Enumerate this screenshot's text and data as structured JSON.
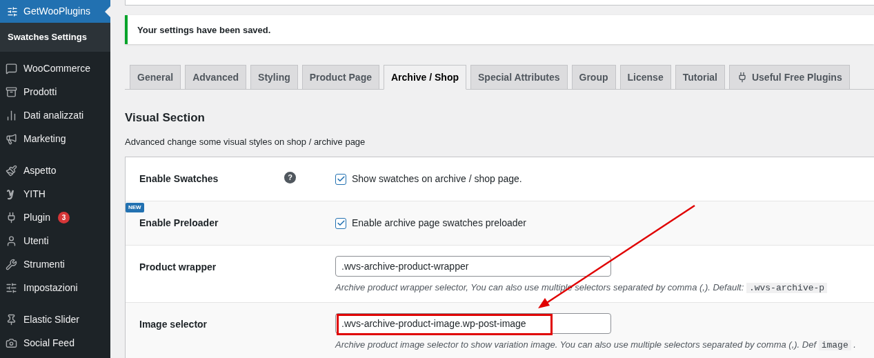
{
  "sidebar": {
    "header": {
      "label": "GetWooPlugins",
      "selected": true
    },
    "submenu": [
      {
        "label": "Swatches Settings",
        "selected": true
      }
    ],
    "groups": [
      [
        {
          "label": "WooCommerce"
        },
        {
          "label": "Prodotti"
        },
        {
          "label": "Dati analizzati"
        },
        {
          "label": "Marketing"
        }
      ],
      [
        {
          "label": "Aspetto"
        },
        {
          "label": "YITH"
        },
        {
          "label": "Plugin",
          "badge": "3"
        },
        {
          "label": "Utenti"
        },
        {
          "label": "Strumenti"
        },
        {
          "label": "Impostazioni"
        }
      ],
      [
        {
          "label": "Elastic Slider"
        },
        {
          "label": "Social Feed"
        }
      ]
    ]
  },
  "notice": {
    "text": "Your settings have been saved."
  },
  "tabs": [
    {
      "label": "General",
      "selected": false
    },
    {
      "label": "Advanced",
      "selected": false
    },
    {
      "label": "Styling",
      "selected": false
    },
    {
      "label": "Product Page",
      "selected": false
    },
    {
      "label": "Archive / Shop",
      "selected": true
    },
    {
      "label": "Special Attributes",
      "selected": false
    },
    {
      "label": "Group",
      "selected": false
    },
    {
      "label": "License",
      "selected": false
    },
    {
      "label": "Tutorial",
      "selected": false
    },
    {
      "label": "Useful Free Plugins",
      "selected": false,
      "kind": "icon"
    }
  ],
  "section": {
    "title": "Visual Section",
    "description": "Advanced change some visual styles on shop / archive page"
  },
  "settings": [
    {
      "kind": "checkbox",
      "label": "Enable Swatches",
      "help": "?",
      "checked": true,
      "option": "Show swatches on archive / shop page."
    },
    {
      "kind": "checkbox",
      "label": "Enable Preloader",
      "badge": "NEW",
      "checked": true,
      "option": "Enable archive page swatches preloader"
    },
    {
      "kind": "text",
      "label": "Product wrapper",
      "value": ".wvs-archive-product-wrapper",
      "description": "Archive product wrapper selector, You can also use multiple selectors separated by comma (,). Default:",
      "code": ".wvs-archive-p"
    },
    {
      "kind": "text",
      "label": "Image selector",
      "value": ".wvs-archive-product-image.wp-post-image",
      "highlighted": true,
      "description": "Archive product image selector to show variation image. You can also use multiple selectors separated by comma (,). Def",
      "code": "image",
      "after": "."
    }
  ]
}
